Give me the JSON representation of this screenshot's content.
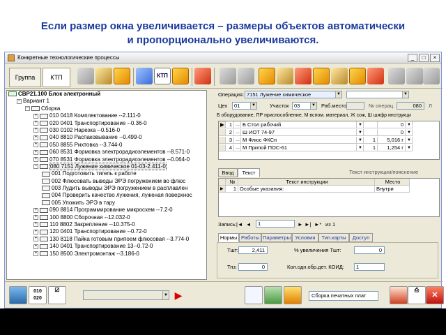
{
  "caption": {
    "line1": "Если размер окна увеличивается – размеры объектов автоматически",
    "line2": "и пропорционально увеличиваются."
  },
  "window": {
    "title": "Конкретные технологические процессы",
    "controls": [
      "_",
      "□",
      "×"
    ]
  },
  "toolbar": {
    "tab_group": "Группа",
    "tab_ktp": "КТП",
    "ktp_icon_label": "КТП"
  },
  "tree": {
    "nodes": [
      {
        "level": 0,
        "text": "СВР21.100 Блок электронный",
        "bold": true,
        "icon": "ktp",
        "expander": ""
      },
      {
        "level": 1,
        "text": "Вариант 1",
        "icon": "none",
        "expander": "−"
      },
      {
        "level": 2,
        "text": "Сборка",
        "icon": "tb",
        "expander": "−"
      },
      {
        "level": 3,
        "text": "010 0418 Комплектование  --2.111-0",
        "icon": "op",
        "expander": "+"
      },
      {
        "level": 3,
        "text": "020 0401 Транспортирование  --0.36-0",
        "icon": "op",
        "expander": "+"
      },
      {
        "level": 3,
        "text": "030 0102 Нарезка  --0.516-0",
        "icon": "op",
        "expander": "+"
      },
      {
        "level": 3,
        "text": "040 8810 Распаковывание  --0.499-0",
        "icon": "op",
        "expander": "+"
      },
      {
        "level": 3,
        "text": "050 8855 Рихтовка  --3.744-0",
        "icon": "op",
        "expander": "+"
      },
      {
        "level": 3,
        "text": "060 8531 Формовка электрорадиоэлементов  --8.571-0",
        "icon": "op",
        "expander": "+"
      },
      {
        "level": 3,
        "text": "070 8531 Формовка электрорадиоэлементов  --0.064-0",
        "icon": "op",
        "expander": "+"
      },
      {
        "level": 3,
        "text": "080 7151 Лужение химическое  01-03-2.411-0",
        "icon": "op",
        "expander": "−"
      },
      {
        "level": 4,
        "text": "001 Подготовить тигель к работе",
        "icon": "step",
        "expander": ""
      },
      {
        "level": 4,
        "text": "002 Флюсовать выводы ЭРЭ погружением во флюс",
        "icon": "step",
        "expander": ""
      },
      {
        "level": 4,
        "text": "003 Лудить выводы ЭРЭ погружением в расплавлен",
        "icon": "step",
        "expander": ""
      },
      {
        "level": 4,
        "text": "004 Проверить качество лужения, луженая поверхнос",
        "icon": "step",
        "expander": ""
      },
      {
        "level": 4,
        "text": "005 Уложить ЭРЭ в тару",
        "icon": "step",
        "expander": ""
      },
      {
        "level": 3,
        "text": "090 8814 Программирование микросхем  --7.2-0",
        "icon": "op",
        "expander": "+"
      },
      {
        "level": 3,
        "text": "100 8800 Сборочная  --12.032-0",
        "icon": "op",
        "expander": "+"
      },
      {
        "level": 3,
        "text": "110 8802 Закрепление  --10.375-0",
        "icon": "op",
        "expander": "+"
      },
      {
        "level": 3,
        "text": "120 0401 Транспортирование  --0.72-0",
        "icon": "op",
        "expander": "+"
      },
      {
        "level": 3,
        "text": "130 8118 Пайка готовым припоем флюсовая  --3.774-0",
        "icon": "op",
        "expander": "+"
      },
      {
        "level": 3,
        "text": "140 0401 Транспортирование  13--0.72-0",
        "icon": "op",
        "expander": "+"
      },
      {
        "level": 3,
        "text": "150 8500 Электромонтаж  --3.186-0",
        "icon": "op",
        "expander": "+"
      }
    ]
  },
  "operation": {
    "label": "Операция:",
    "value": "7151 Лужение химическое",
    "ceh_label": "Цех",
    "ceh_value": "01",
    "uchastok_label": "Участок",
    "uchastok_value": "03",
    "rabmesto_label": "Раб.место",
    "noper_label": "№ операц.",
    "noper_value": "080",
    "noper_suffix": "Л",
    "equip_header": "Б оборудование, ПР приспособление, М вспом. материал, Ж сож, Ш шифр инструкци"
  },
  "equip_rows": [
    {
      "n": "1",
      "code": "Б",
      "name": "Б Стол рабочий",
      "qty": "",
      "val": "0"
    },
    {
      "n": "2",
      "code": "Ш",
      "name": "Ш ИОТ 74-97",
      "qty": "",
      "val": "0"
    },
    {
      "n": "3",
      "code": "М",
      "name": "М Флюс ФКСп",
      "qty": "1",
      "val": "5,016 г"
    },
    {
      "n": "4",
      "code": "М",
      "name": "М Припой ПОС-61",
      "qty": "1",
      "val": "1,254 г"
    }
  ],
  "text_tabs": {
    "tab1": "Ввод",
    "tab2": "Текст",
    "title": "Текст инструкции/пояснение",
    "col_n": "№",
    "col_text": "Текст инструкции",
    "col_place": "Место",
    "row_n": "1",
    "row_text": "Особые указания:",
    "row_place": "Внутри"
  },
  "nav": {
    "label": "Запись:",
    "current": "1",
    "of": "из",
    "total": "1",
    "first": "|◄",
    "prev": "◄",
    "next": "►",
    "last": "►|",
    "new": "►*"
  },
  "bottom_tabs": [
    "Нормы",
    "Работы",
    "Параметры",
    "Условия",
    "Тип.карты",
    "Доступ"
  ],
  "norms": {
    "tsht_label": "Тшт:",
    "tsht_value": "2,411",
    "tpz_label": "Тпз:",
    "tpz_value": "0",
    "inc_label": "% увеличения Тшт:",
    "inc_value": "0",
    "koid_label": "Кол.одн.обр.дет. КОИД:",
    "koid_value": "1"
  },
  "bottombar": {
    "code_icon": "010 020",
    "status_text": "Сборка печатных плат"
  }
}
